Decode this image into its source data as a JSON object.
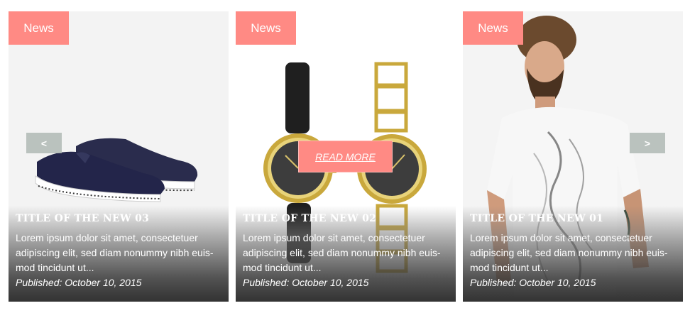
{
  "cards": [
    {
      "badge": "News",
      "title": "TITLE OF THE NEW 03",
      "excerpt": "Lorem ipsum dolor sit amet, consectetuer adipiscing elit, sed diam nonummy nibh euis-mod tincidunt ut...",
      "published": "Published: October 10, 2015"
    },
    {
      "badge": "News",
      "title": "TITLE OF THE NEW 02",
      "excerpt": "Lorem ipsum dolor sit amet, consectetuer adipiscing elit, sed diam nonummy nibh euis-mod tincidunt ut...",
      "published": "Published: October 10, 2015"
    },
    {
      "badge": "News",
      "title": "TITLE OF THE NEW 01",
      "excerpt": "Lorem ipsum dolor sit amet, consectetuer adipiscing elit, sed diam nonummy nibh euis-mod tincidunt ut...",
      "published": "Published: October 10, 2015"
    }
  ],
  "controls": {
    "prev_label": "<",
    "next_label": ">",
    "read_more_label": "READ MORE"
  },
  "colors": {
    "badge": "#ff8a84",
    "arrow": "#afb9b4"
  }
}
